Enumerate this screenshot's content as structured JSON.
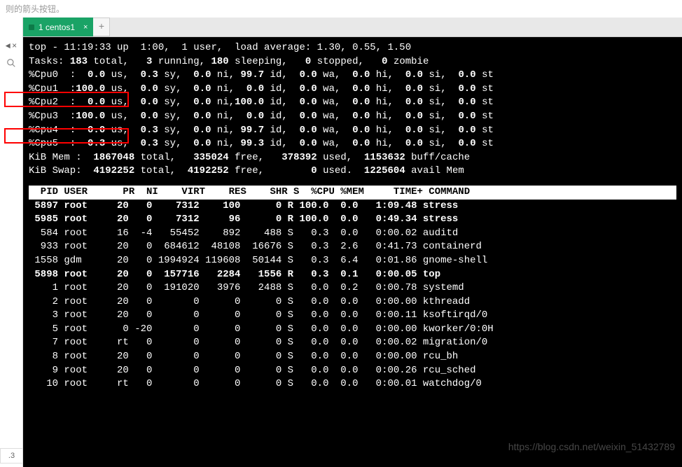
{
  "hint_text": "则的箭头按钮。",
  "tab": {
    "label": "1 centos1",
    "close": "×"
  },
  "new_tab": "+",
  "gutter": {
    "close": "×",
    "left": "◄"
  },
  "status_corner": ".3",
  "watermark": "https://blog.csdn.net/weixin_51432789",
  "summary": {
    "line1": "top - 11:19:33 up  1:00,  1 user,  load average: 1.30, 0.55, 1.50",
    "tasks_pre": "Tasks: ",
    "tasks_total": "183",
    "tasks_mid1": " total,   ",
    "tasks_running": "3",
    "tasks_mid2": " running, ",
    "tasks_sleeping": "180",
    "tasks_mid3": " sleeping,   ",
    "tasks_stopped": "0",
    "tasks_mid4": " stopped,   ",
    "tasks_zombie": "0",
    "tasks_end": " zombie"
  },
  "cpus": [
    {
      "label": "%Cpu0  :  ",
      "us": "0.0",
      "sy": "0.3",
      "ni": "0.0",
      "id": "99.7",
      "wa": "0.0",
      "hi": "0.0",
      "si": "0.0",
      "st": "0.0"
    },
    {
      "label": "%Cpu1  :",
      "us": "100.0",
      "sy": "0.0",
      "ni": "0.0",
      "id": " 0.0",
      "wa": "0.0",
      "hi": "0.0",
      "si": "0.0",
      "st": "0.0"
    },
    {
      "label": "%Cpu2  :  ",
      "us": "0.0",
      "sy": "0.0",
      "ni": "0.0",
      "id_alt": "100.0",
      "wa": "0.0",
      "hi": "0.0",
      "si": "0.0",
      "st": "0.0"
    },
    {
      "label": "%Cpu3  :",
      "us": "100.0",
      "sy": "0.0",
      "ni": "0.0",
      "id": " 0.0",
      "wa": "0.0",
      "hi": "0.0",
      "si": "0.0",
      "st": "0.0"
    },
    {
      "label": "%Cpu4  :  ",
      "us": "0.0",
      "sy": "0.3",
      "ni": "0.0",
      "id": "99.7",
      "wa": "0.0",
      "hi": "0.0",
      "si": "0.0",
      "st": "0.0"
    },
    {
      "label": "%Cpu5  :  ",
      "us": "0.3",
      "sy": "0.3",
      "ni": "0.0",
      "id": "99.3",
      "wa": "0.0",
      "hi": "0.0",
      "si": "0.0",
      "st": "0.0"
    }
  ],
  "mem": {
    "line_pre": "KiB Mem : ",
    "total": " 1867048",
    "mid1": " total,   ",
    "free": "335024",
    "mid2": " free,   ",
    "used": "378392",
    "mid3": " used,  ",
    "buff": "1153632",
    "end": " buff/cache"
  },
  "swap": {
    "line_pre": "KiB Swap:  ",
    "total": "4192252",
    "mid1": " total,  ",
    "free": "4192252",
    "mid2": " free,        ",
    "used": "0",
    "mid3": " used.  ",
    "avail": "1225604",
    "end": " avail Mem"
  },
  "header": "  PID USER      PR  NI    VIRT    RES    SHR S  %CPU %MEM     TIME+ COMMAND                    ",
  "procs": [
    {
      "bold": true,
      "pid": " 5897",
      "user": "root    ",
      "pr": "20",
      "ni": "  0",
      "virt": "   7312",
      "res": "   100",
      "shr": "     0",
      "s": "R",
      "cpu": "100.0",
      "mem": " 0.0",
      "time": "  1:09.48",
      "cmd": "stress"
    },
    {
      "bold": true,
      "pid": " 5985",
      "user": "root    ",
      "pr": "20",
      "ni": "  0",
      "virt": "   7312",
      "res": "    96",
      "shr": "     0",
      "s": "R",
      "cpu": "100.0",
      "mem": " 0.0",
      "time": "  0:49.34",
      "cmd": "stress"
    },
    {
      "bold": false,
      "pid": "  584",
      "user": "root    ",
      "pr": "16",
      "ni": " -4",
      "virt": "  55452",
      "res": "   892",
      "shr": "   488",
      "s": "S",
      "cpu": "  0.3",
      "mem": " 0.0",
      "time": "  0:00.02",
      "cmd": "auditd"
    },
    {
      "bold": false,
      "pid": "  933",
      "user": "root    ",
      "pr": "20",
      "ni": "  0",
      "virt": " 684612",
      "res": " 48108",
      "shr": " 16676",
      "s": "S",
      "cpu": "  0.3",
      "mem": " 2.6",
      "time": "  0:41.73",
      "cmd": "containerd"
    },
    {
      "bold": false,
      "pid": " 1558",
      "user": "gdm     ",
      "pr": "20",
      "ni": "  0",
      "virt": "1994924",
      "res": "119608",
      "shr": " 50144",
      "s": "S",
      "cpu": "  0.3",
      "mem": " 6.4",
      "time": "  0:01.86",
      "cmd": "gnome-shell"
    },
    {
      "bold": true,
      "pid": " 5898",
      "user": "root    ",
      "pr": "20",
      "ni": "  0",
      "virt": " 157716",
      "res": "  2284",
      "shr": "  1556",
      "s": "R",
      "cpu": "  0.3",
      "mem": " 0.1",
      "time": "  0:00.05",
      "cmd": "top"
    },
    {
      "bold": false,
      "pid": "    1",
      "user": "root    ",
      "pr": "20",
      "ni": "  0",
      "virt": " 191020",
      "res": "  3976",
      "shr": "  2488",
      "s": "S",
      "cpu": "  0.0",
      "mem": " 0.2",
      "time": "  0:00.78",
      "cmd": "systemd"
    },
    {
      "bold": false,
      "pid": "    2",
      "user": "root    ",
      "pr": "20",
      "ni": "  0",
      "virt": "      0",
      "res": "     0",
      "shr": "     0",
      "s": "S",
      "cpu": "  0.0",
      "mem": " 0.0",
      "time": "  0:00.00",
      "cmd": "kthreadd"
    },
    {
      "bold": false,
      "pid": "    3",
      "user": "root    ",
      "pr": "20",
      "ni": "  0",
      "virt": "      0",
      "res": "     0",
      "shr": "     0",
      "s": "S",
      "cpu": "  0.0",
      "mem": " 0.0",
      "time": "  0:00.11",
      "cmd": "ksoftirqd/0"
    },
    {
      "bold": false,
      "pid": "    5",
      "user": "root    ",
      "pr": " 0",
      "ni": "-20",
      "virt": "      0",
      "res": "     0",
      "shr": "     0",
      "s": "S",
      "cpu": "  0.0",
      "mem": " 0.0",
      "time": "  0:00.00",
      "cmd": "kworker/0:0H"
    },
    {
      "bold": false,
      "pid": "    7",
      "user": "root    ",
      "pr": "rt",
      "ni": "  0",
      "virt": "      0",
      "res": "     0",
      "shr": "     0",
      "s": "S",
      "cpu": "  0.0",
      "mem": " 0.0",
      "time": "  0:00.02",
      "cmd": "migration/0"
    },
    {
      "bold": false,
      "pid": "    8",
      "user": "root    ",
      "pr": "20",
      "ni": "  0",
      "virt": "      0",
      "res": "     0",
      "shr": "     0",
      "s": "S",
      "cpu": "  0.0",
      "mem": " 0.0",
      "time": "  0:00.00",
      "cmd": "rcu_bh"
    },
    {
      "bold": false,
      "pid": "    9",
      "user": "root    ",
      "pr": "20",
      "ni": "  0",
      "virt": "      0",
      "res": "     0",
      "shr": "     0",
      "s": "S",
      "cpu": "  0.0",
      "mem": " 0.0",
      "time": "  0:00.26",
      "cmd": "rcu_sched"
    },
    {
      "bold": false,
      "pid": "   10",
      "user": "root    ",
      "pr": "rt",
      "ni": "  0",
      "virt": "      0",
      "res": "     0",
      "shr": "     0",
      "s": "S",
      "cpu": "  0.0",
      "mem": " 0.0",
      "time": "  0:00.01",
      "cmd": "watchdog/0"
    }
  ]
}
